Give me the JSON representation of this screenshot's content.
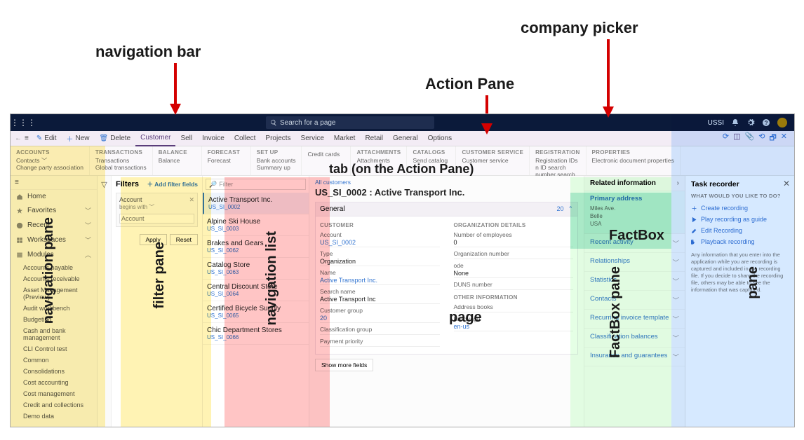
{
  "annotations": {
    "nav_bar": "navigation bar",
    "action_pane": "Action Pane",
    "company_picker": "company picker",
    "tab_on_action_pane": "tab (on the Action Pane)",
    "nav_pane": "navigation pane",
    "filter_pane": "filter pane",
    "nav_list": "navigation list",
    "page": "page",
    "factbox": "FactBox",
    "factbox_pane": "FactBox pane",
    "pane": "pane"
  },
  "topbar": {
    "search_placeholder": "Search for a page",
    "company": "USSI",
    "bell": "🔔"
  },
  "actionbar": {
    "items": [
      "Edit",
      "New",
      "Delete",
      "Customer",
      "Sell",
      "Invoice",
      "Collect",
      "Projects",
      "Service",
      "Market",
      "Retail",
      "General",
      "Options"
    ],
    "selected": "Customer",
    "icons": {
      "edit": "✎",
      "new": "＋",
      "delete": "🗑"
    }
  },
  "actiontabs": [
    {
      "h": "ACCOUNTS",
      "rows": [
        "Contacts ﹀",
        "Change party association"
      ]
    },
    {
      "h": "TRANSACTIONS",
      "rows": [
        "Transactions",
        "Global transactions"
      ]
    },
    {
      "h": "BALANCE",
      "rows": [
        "Balance"
      ]
    },
    {
      "h": "FORECAST",
      "rows": [
        "Forecast"
      ]
    },
    {
      "h": "SET UP",
      "rows": [
        "Bank accounts",
        "Summary up"
      ]
    },
    {
      "h": "",
      "rows": [
        "Credit cards"
      ]
    },
    {
      "h": "ATTACHMENTS",
      "rows": [
        "Attachments"
      ]
    },
    {
      "h": "CATALOGS",
      "rows": [
        "Send catalog"
      ]
    },
    {
      "h": "CUSTOMER SERVICE",
      "rows": [
        "Customer service"
      ]
    },
    {
      "h": "REGISTRATION",
      "rows": [
        "Registration IDs",
        "n ID search",
        "number search"
      ]
    },
    {
      "h": "PROPERTIES",
      "rows": [
        "Electronic document properties"
      ]
    }
  ],
  "leftnav": {
    "items": [
      {
        "icon": "home",
        "label": "Home"
      },
      {
        "icon": "star",
        "label": "Favorites",
        "chev": "﹀"
      },
      {
        "icon": "clock",
        "label": "Recent",
        "chev": "﹀"
      },
      {
        "icon": "grid",
        "label": "Workspaces",
        "chev": "﹀"
      },
      {
        "icon": "mods",
        "label": "Modules",
        "chev": "︿"
      }
    ],
    "modules": [
      "Accounts payable",
      "Accounts receivable",
      "Asset Management (Preview)",
      "Audit workbench",
      "Budgeting",
      "Cash and bank management",
      "CLI Control test",
      "Common",
      "Consolidations",
      "Cost accounting",
      "Cost management",
      "Credit and collections",
      "Demo data"
    ]
  },
  "filterpane": {
    "title": "Filters",
    "add": "＋ Add filter fields",
    "field_label": "Account",
    "op": "begins with ﹀",
    "apply": "Apply",
    "reset": "Reset"
  },
  "navlist": {
    "filter_placeholder": "Filter",
    "rows": [
      {
        "n": "Active Transport Inc.",
        "c": "US_SI_0002",
        "sel": true
      },
      {
        "n": "Alpine Ski House",
        "c": "US_SI_0003"
      },
      {
        "n": "Brakes and Gears",
        "c": "US_SI_0062"
      },
      {
        "n": "Catalog Store",
        "c": "US_SI_0063"
      },
      {
        "n": "Central Discount Store",
        "c": "US_SI_0064"
      },
      {
        "n": "Certified Bicycle Supply",
        "c": "US_SI_0065"
      },
      {
        "n": "Chic Department Stores",
        "c": "US_SI_0066"
      }
    ]
  },
  "page": {
    "crumb": "All customers",
    "title": "US_SI_0002 : Active Transport Inc.",
    "section": "General",
    "section_count": "20",
    "col1_h": "CUSTOMER",
    "col2_h": "ORGANIZATION DETAILS",
    "fields1": [
      {
        "l": "Account",
        "v": "US_SI_0002",
        "link": true
      },
      {
        "l": "Type",
        "v": "Organization"
      },
      {
        "l": "Name",
        "v": "Active Transport Inc.",
        "link": true
      },
      {
        "l": "Search name",
        "v": "Active Transport Inc"
      },
      {
        "l": "Customer group",
        "v": "20",
        "link": true
      },
      {
        "l": "Classification group",
        "v": ""
      },
      {
        "l": "Payment priority",
        "v": ""
      }
    ],
    "fields2": [
      {
        "l": "Number of employees",
        "v": "0"
      },
      {
        "l": "Organization number",
        "v": ""
      },
      {
        "l": "ode",
        "v": "None"
      },
      {
        "l": "DUNS number",
        "v": ""
      }
    ],
    "col2_h2": "OTHER INFORMATION",
    "fields3": [
      {
        "l": "Address books",
        "v": ""
      },
      {
        "l": "Language",
        "v": "en-us",
        "link": true
      }
    ],
    "showmore": "Show more fields"
  },
  "factbox": {
    "header": "Related information",
    "primary": {
      "t": "Primary address",
      "lines": [
        "Miles Ave.",
        "Belle",
        "USA"
      ]
    },
    "items": [
      "Recent activity",
      "Relationships",
      "Statistics",
      "Contacts",
      "Recurring invoice template",
      "Classification balances",
      "Insurance and guarantees"
    ]
  },
  "taskpane": {
    "title": "Task recorder",
    "q": "WHAT WOULD YOU LIKE TO DO?",
    "links": [
      "Create recording",
      "Play recording as guide",
      "Edit Recording",
      "Playback recording"
    ],
    "note": "Any information that you enter into the application while you are recording is captured and included in the recording file. If you decide to share the recording file, others may be able to see the information that was captured."
  }
}
